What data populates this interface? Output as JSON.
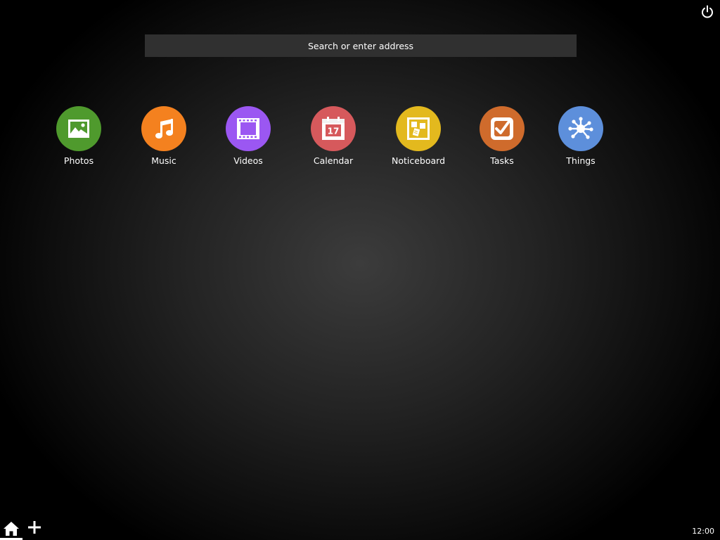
{
  "search": {
    "placeholder": "Search or enter address"
  },
  "apps": [
    {
      "label": "Photos",
      "color": "#4f9a2d",
      "icon": "photo-icon"
    },
    {
      "label": "Music",
      "color": "#f4811f",
      "icon": "music-note-icon"
    },
    {
      "label": "Videos",
      "color": "#9b57f2",
      "icon": "film-strip-icon"
    },
    {
      "label": "Calendar",
      "color": "#d6595c",
      "icon": "calendar-icon",
      "icon_text": "17"
    },
    {
      "label": "Noticeboard",
      "color": "#e3b91e",
      "icon": "noticeboard-icon"
    },
    {
      "label": "Tasks",
      "color": "#cf6b2c",
      "icon": "checkbox-icon"
    },
    {
      "label": "Things",
      "color": "#5d8fdb",
      "icon": "network-hub-icon"
    }
  ],
  "status_bar": {
    "time": "12:00"
  },
  "system": {
    "power_icon": "power-icon",
    "home_icon": "home-icon",
    "add_icon": "plus-icon"
  }
}
